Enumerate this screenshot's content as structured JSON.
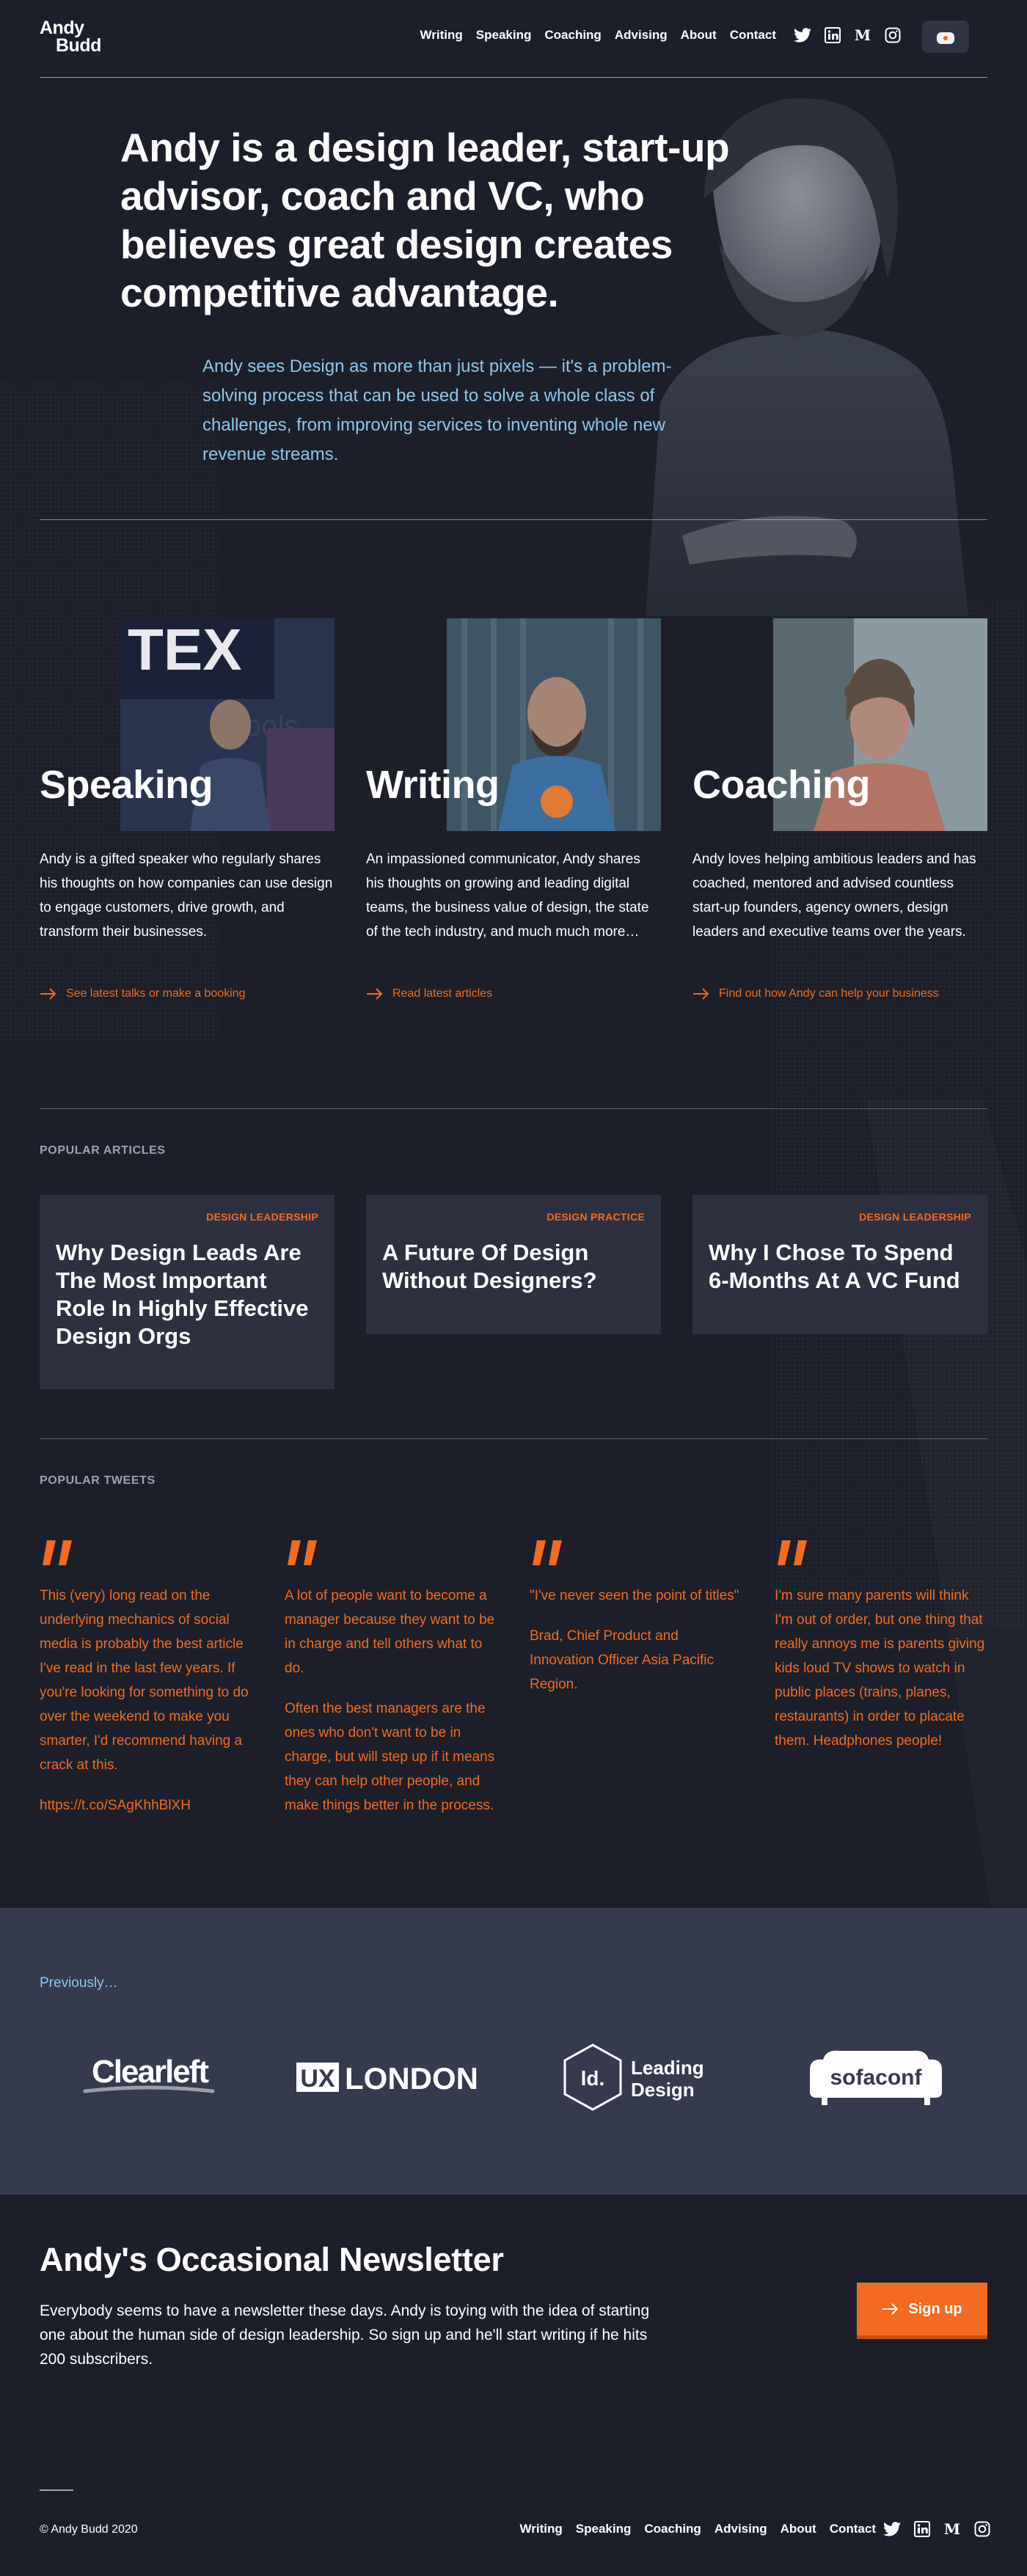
{
  "header": {
    "logo_line1": "Andy",
    "logo_line2": "Budd",
    "nav": [
      "Writing",
      "Speaking",
      "Coaching",
      "Advising",
      "About",
      "Contact"
    ],
    "social_icons": [
      "twitter-icon",
      "linkedin-icon",
      "medium-icon",
      "instagram-icon"
    ]
  },
  "hero": {
    "title": "Andy is a design leader, start-up advisor, coach and VC, who believes great design creates competitive advantage.",
    "lede": "Andy sees Design as more than just pixels — it's a problem-solving process that can be used to solve a whole class of challenges, from improving services to inventing whole new revenue streams."
  },
  "services": [
    {
      "title": "Speaking",
      "body": "Andy is a gifted speaker who regularly shares his thoughts on how companies can use design to engage customers, drive growth, and transform their businesses.",
      "link": "See latest talks or make a booking"
    },
    {
      "title": "Writing",
      "body": "An impassioned communicator, Andy shares his thoughts on growing and leading digital teams, the business value of design, the state of the tech industry, and much much more…",
      "link": "Read latest articles"
    },
    {
      "title": "Coaching",
      "body": "Andy loves helping ambitious leaders and has coached, mentored and advised countless start-up founders, agency owners, design leaders and executive teams over the years.",
      "link": "Find out how Andy can help your business"
    }
  ],
  "articles": {
    "label": "Popular Articles",
    "items": [
      {
        "tag": "Design Leadership",
        "title": "Why Design Leads Are The Most Important Role In Highly Effective Design Orgs"
      },
      {
        "tag": "Design Practice",
        "title": "A Future Of Design Without Designers?"
      },
      {
        "tag": "Design Leadership",
        "title": "Why I Chose To Spend 6-Months At A VC Fund"
      }
    ]
  },
  "tweets": {
    "label": "Popular Tweets",
    "items": [
      {
        "paragraphs": [
          "This (very) long read on the underlying mechanics of social media is probably the best article I've read in the last few years. If you're looking for something to do over the weekend to make you smarter, I'd recommend having a crack at this.",
          "https://t.co/SAgKhhBlXH"
        ]
      },
      {
        "paragraphs": [
          "A lot of people want to become a manager because they want to be in charge and tell others what to do.",
          "Often the best managers are the ones who don't want to be in charge, but will step up if it means they can help other people, and make things better in the process."
        ]
      },
      {
        "paragraphs": [
          "\"I've never seen the point of titles\"",
          "Brad, Chief Product and Innovation Officer Asia Pacific Region."
        ]
      },
      {
        "paragraphs": [
          "I'm sure many parents will think I'm out of order, but one thing that really annoys me is parents giving kids loud TV shows to watch in public places (trains, planes, restaurants) in order to placate them. Headphones people!"
        ]
      }
    ]
  },
  "previously": {
    "label": "Previously…",
    "logos": {
      "clearleft": "Clearleft",
      "ux_box": "UX",
      "ux_rest": "LONDON",
      "ld_badge": "ld.",
      "ld_line1": "Leading",
      "ld_line2": "Design",
      "sofaconf": "sofaconf"
    }
  },
  "newsletter": {
    "title": "Andy's Occasional Newsletter",
    "body": "Everybody seems to have a newsletter these days. Andy is toying with the idea of starting one about the human side of design leadership. So sign up and he'll start writing if he hits 200 subscribers.",
    "button": "Sign up"
  },
  "footer": {
    "copyright": "© Andy Budd 2020",
    "nav": [
      "Writing",
      "Speaking",
      "Coaching",
      "Advising",
      "About",
      "Contact"
    ]
  },
  "colors": {
    "background": "#1c1f2a",
    "accent": "#f26b21",
    "lede_blue": "#8fc6ee",
    "card": "#2d313f",
    "band": "#353a4e"
  }
}
